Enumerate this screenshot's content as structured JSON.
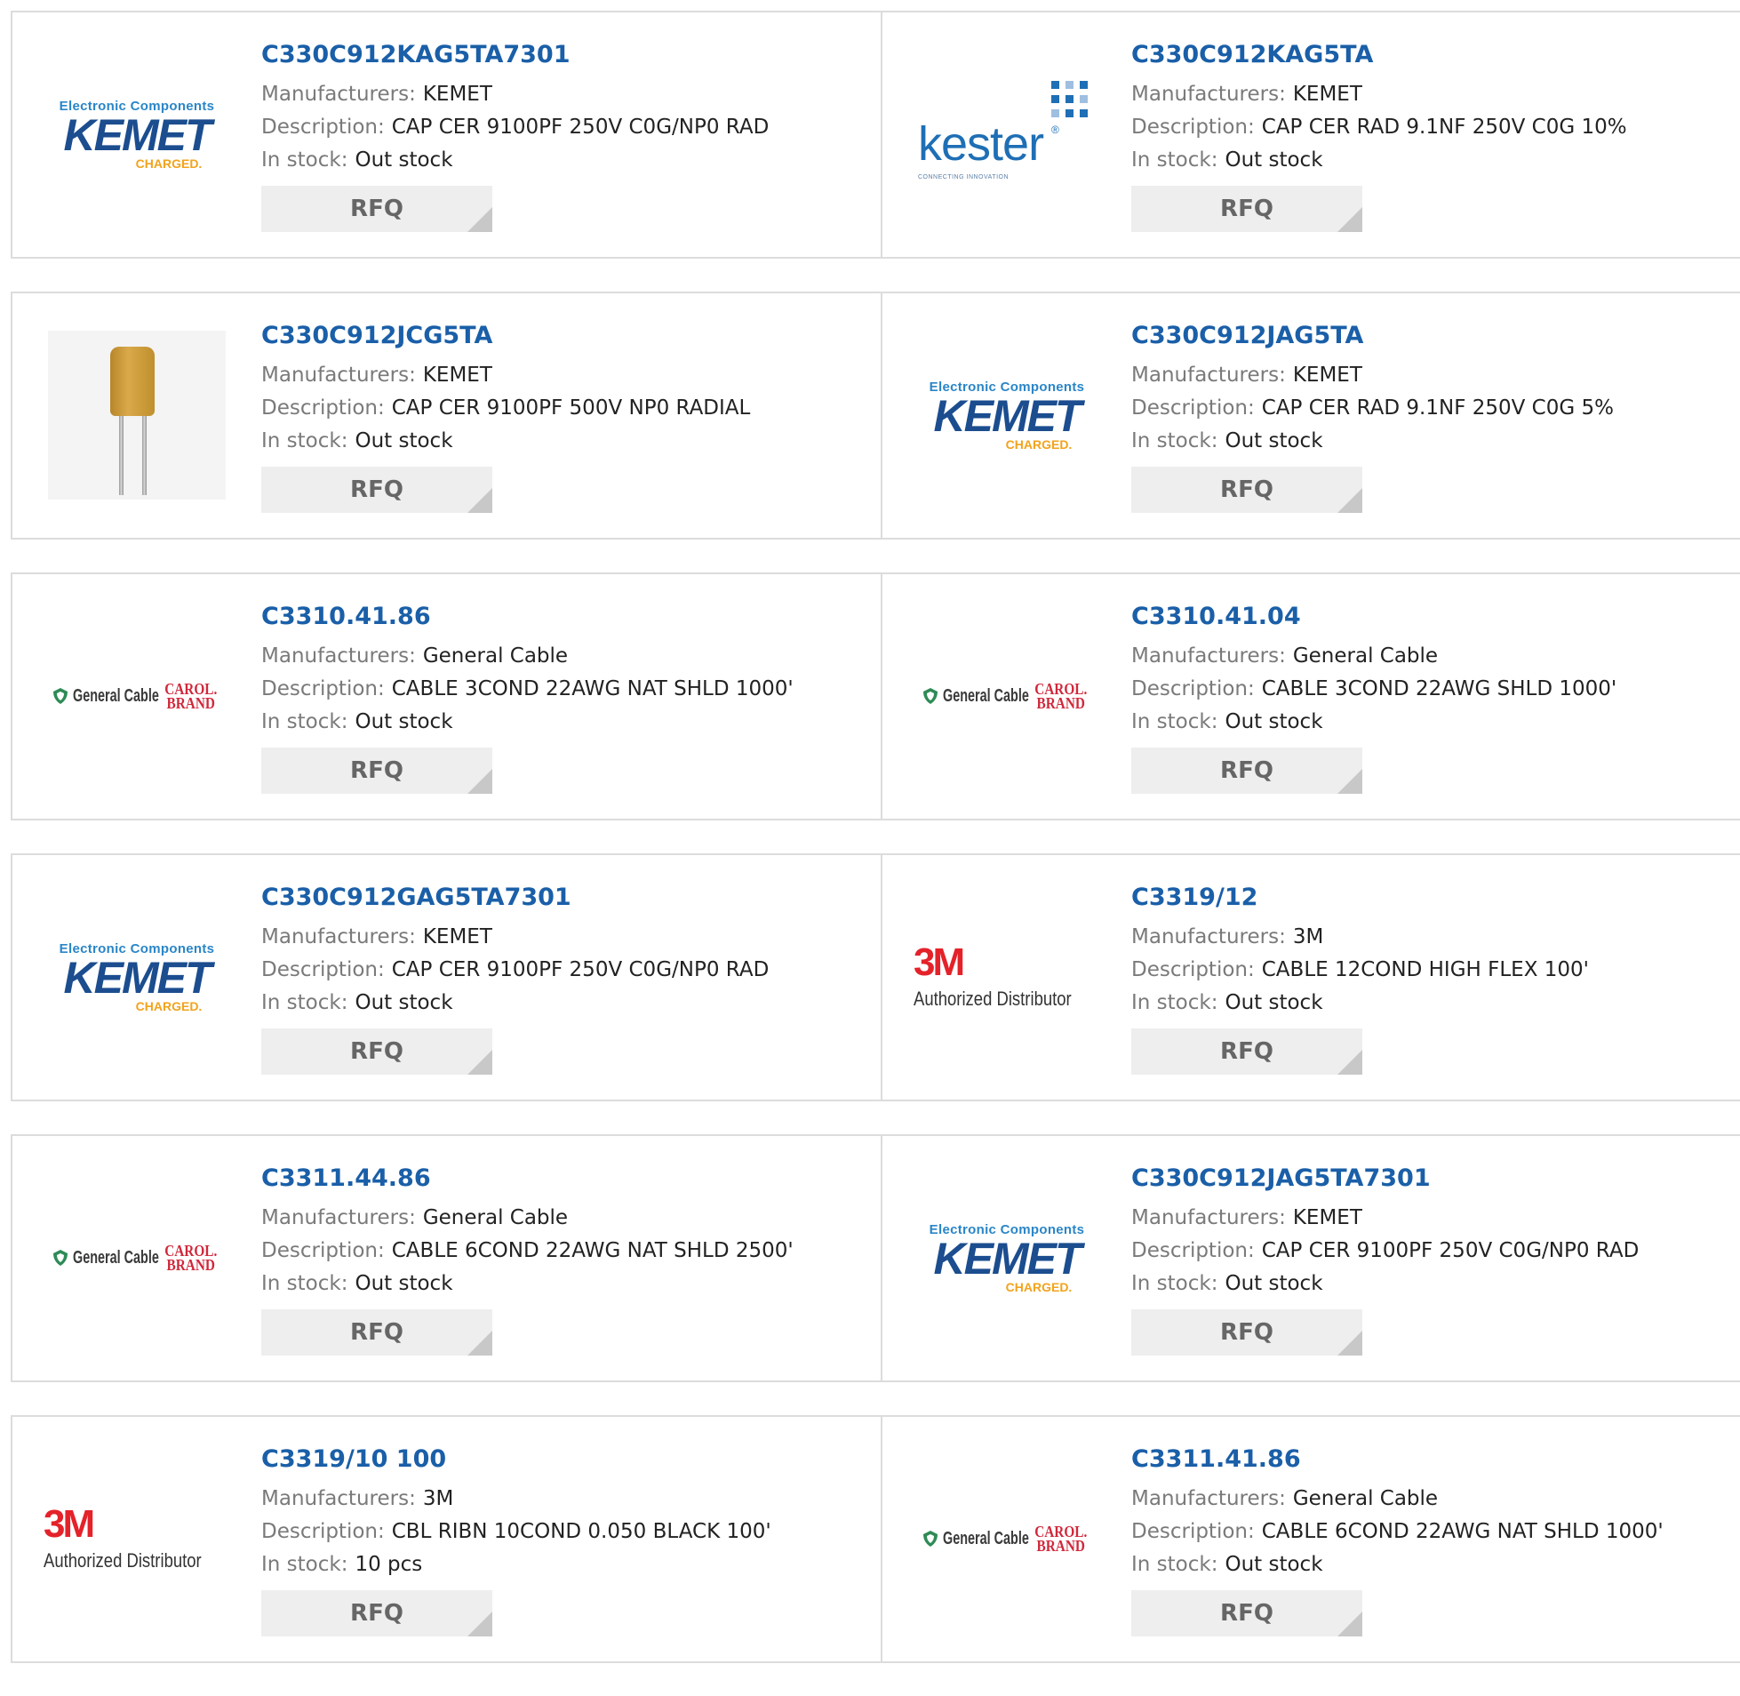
{
  "labels": {
    "manufacturers": "Manufacturers:",
    "description": "Description:",
    "in_stock": "In stock:",
    "rfq": "RFQ"
  },
  "logo_text": {
    "kemet_top": "Electronic Components",
    "kemet_name": "KEMET",
    "kemet_charged": "CHARGED.",
    "kester_name": "kester",
    "kester_tag": "CONNECTING INNOVATION",
    "gc_name": "General Cable",
    "gc_carol": "CAROL.",
    "gc_brand": "BRAND",
    "m3_big": "3M",
    "m3_sub": "Authorized Distributor"
  },
  "colors": {
    "part_link": "#1a5fa8",
    "label_gray": "#7a7a7a",
    "rfq_bg": "#eeeeee",
    "border": "#dcdcdc"
  },
  "products": [
    {
      "part": "C330C912KAG5TA7301",
      "manufacturer": "KEMET",
      "description": "CAP CER 9100PF 250V C0G/NP0 RAD",
      "stock": "Out stock",
      "logo": "kemet-logo"
    },
    {
      "part": "C330C912KAG5TA",
      "manufacturer": "KEMET",
      "description": "CAP CER RAD 9.1NF 250V C0G 10%",
      "stock": "Out stock",
      "logo": "kester-logo"
    },
    {
      "part": "C330C912JCG5TA",
      "manufacturer": "KEMET",
      "description": "CAP CER 9100PF 500V NP0 RADIAL",
      "stock": "Out stock",
      "logo": "capacitor-photo"
    },
    {
      "part": "C330C912JAG5TA",
      "manufacturer": "KEMET",
      "description": "CAP CER RAD 9.1NF 250V C0G 5%",
      "stock": "Out stock",
      "logo": "kemet-logo"
    },
    {
      "part": "C3310.41.86",
      "manufacturer": "General Cable",
      "description": "CABLE 3COND 22AWG NAT SHLD 1000'",
      "stock": "Out stock",
      "logo": "general-cable-logo"
    },
    {
      "part": "C3310.41.04",
      "manufacturer": "General Cable",
      "description": "CABLE 3COND 22AWG SHLD 1000'",
      "stock": "Out stock",
      "logo": "general-cable-logo"
    },
    {
      "part": "C330C912GAG5TA7301",
      "manufacturer": "KEMET",
      "description": "CAP CER 9100PF 250V C0G/NP0 RAD",
      "stock": "Out stock",
      "logo": "kemet-logo"
    },
    {
      "part": "C3319/12",
      "manufacturer": "3M",
      "description": "CABLE 12COND HIGH FLEX 100'",
      "stock": "Out stock",
      "logo": "3m-logo"
    },
    {
      "part": "C3311.44.86",
      "manufacturer": "General Cable",
      "description": "CABLE 6COND 22AWG NAT SHLD 2500'",
      "stock": "Out stock",
      "logo": "general-cable-logo"
    },
    {
      "part": "C330C912JAG5TA7301",
      "manufacturer": "KEMET",
      "description": "CAP CER 9100PF 250V C0G/NP0 RAD",
      "stock": "Out stock",
      "logo": "kemet-logo"
    },
    {
      "part": "C3319/10 100",
      "manufacturer": "3M",
      "description": "CBL RIBN 10COND 0.050 BLACK 100'",
      "stock": "10 pcs",
      "logo": "3m-logo"
    },
    {
      "part": "C3311.41.86",
      "manufacturer": "General Cable",
      "description": "CABLE 6COND 22AWG NAT SHLD 1000'",
      "stock": "Out stock",
      "logo": "general-cable-logo"
    }
  ]
}
